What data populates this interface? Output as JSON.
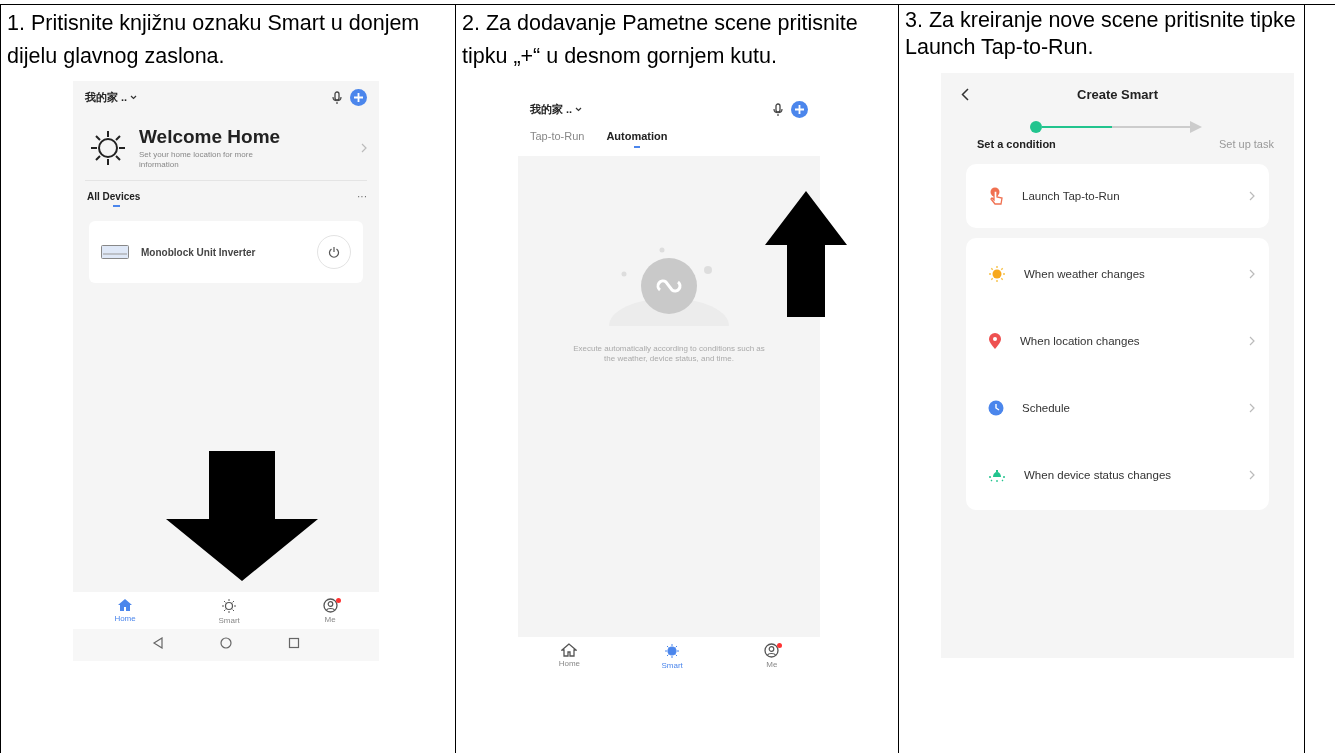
{
  "steps": [
    {
      "kind": "home",
      "instruction": "1. Pritisnite knjižnu oznaku Smart u donjem dijelu glavnog zaslona.",
      "screen": {
        "home_name": "我的家 ..",
        "welcome_title": "Welcome Home",
        "welcome_subtitle": "Set your home location for more information",
        "section_title": "All Devices",
        "more": "···",
        "device": "Monoblock Unit Inverter",
        "nav": [
          {
            "label": "Home",
            "selected": true
          },
          {
            "label": "Smart",
            "selected": false
          },
          {
            "label": "Me",
            "selected": false,
            "notification": true
          }
        ]
      }
    },
    {
      "kind": "automation",
      "instruction": "2. Za dodavanje Pametne scene pritisnite tipku „+“ u desnom gornjem kutu.",
      "screen": {
        "home_name": "我的家 ..",
        "tabs": [
          {
            "label": "Tap-to-Run",
            "selected": false
          },
          {
            "label": "Automation",
            "selected": true
          }
        ],
        "empty_text": "Execute automatically according to conditions such as the weather, device status, and time.",
        "nav": [
          {
            "label": "Home",
            "selected": false
          },
          {
            "label": "Smart",
            "selected": true
          },
          {
            "label": "Me",
            "selected": false,
            "notification": true
          }
        ]
      }
    },
    {
      "kind": "create",
      "instruction": "3. Za kreiranje nove scene pritisnite tipke Launch Tap-to-Run.",
      "screen": {
        "title": "Create Smart",
        "steps": [
          {
            "label": "Set a condition",
            "selected": true
          },
          {
            "label": "Set up task",
            "selected": false
          }
        ],
        "groups": [
          [
            {
              "kind": "tap",
              "label": "Launch Tap-to-Run"
            }
          ],
          [
            {
              "kind": "weather",
              "label": "When weather changes"
            },
            {
              "kind": "location",
              "label": "When location changes"
            },
            {
              "kind": "schedule",
              "label": "Schedule"
            },
            {
              "kind": "device",
              "label": "When device status changes"
            }
          ]
        ]
      }
    }
  ]
}
